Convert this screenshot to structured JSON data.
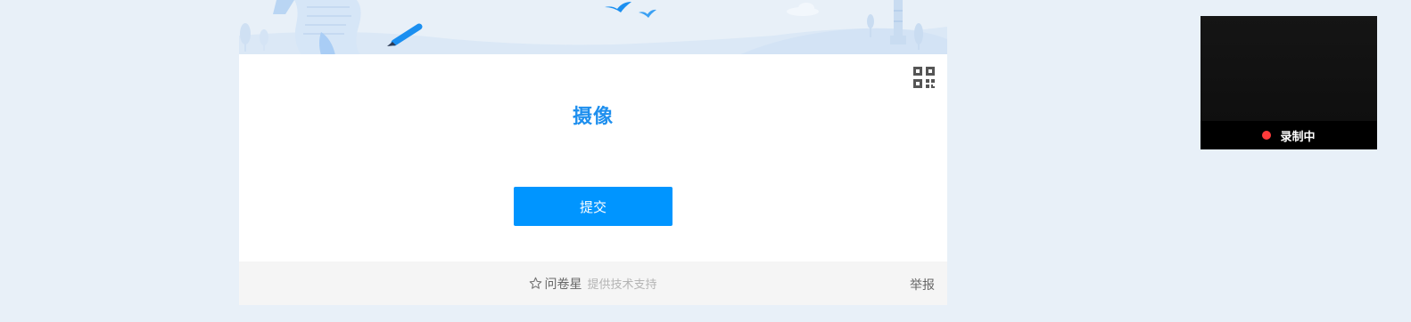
{
  "survey": {
    "title": "摄像",
    "submit_label": "提交",
    "qr_icon": "qr-code-icon"
  },
  "footer": {
    "brand": "问卷星",
    "support": "提供技术支持",
    "report": "举报",
    "star_icon": "star-outline-icon"
  },
  "recorder": {
    "status": "录制中",
    "indicator_color": "#ff3b3b"
  },
  "colors": {
    "accent": "#0095ff",
    "title": "#1e8fee",
    "page_bg": "#e8f0f8"
  }
}
